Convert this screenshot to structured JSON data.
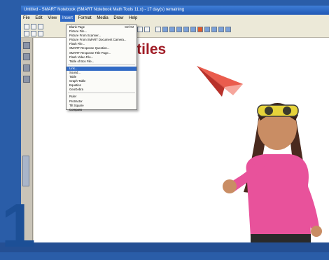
{
  "window": {
    "title": "Untitled - SMART Notebook (SMART Notebook Math Tools 11.x) - 17 day(s) remaining"
  },
  "menubar": {
    "items": [
      "File",
      "Edit",
      "View",
      "Insert",
      "Format",
      "Media",
      "Draw",
      "Help"
    ]
  },
  "insert_menu": [
    {
      "label": "Blank Page",
      "shortcut": "Ctrl+M"
    },
    {
      "label": "Picture File..."
    },
    {
      "label": "Picture From Scanner..."
    },
    {
      "label": "Picture From SMART Document Camera..."
    },
    {
      "label": "Flash File..."
    },
    {
      "label": "SMART Response Question..."
    },
    {
      "label": "SMART Response Title Page..."
    },
    {
      "label": "Flash Video File..."
    },
    {
      "label": "Table of Box File..."
    },
    {
      "separator": true
    },
    {
      "label": "Link...",
      "selected": true
    },
    {
      "label": "Sound..."
    },
    {
      "label": "Table"
    },
    {
      "label": "Graph Table"
    },
    {
      "label": "Equation"
    },
    {
      "label": "GeoGebra"
    },
    {
      "separator": true
    },
    {
      "label": "Ruler"
    },
    {
      "label": "Protractor"
    },
    {
      "label": "Tilt Square"
    },
    {
      "label": "Compass"
    }
  ],
  "canvas": {
    "title": "jectiles"
  },
  "overlay": {
    "number": "1"
  },
  "colors": {
    "accent": "#1c4f96",
    "title": "#a01c26",
    "plane": "#e0473a"
  }
}
